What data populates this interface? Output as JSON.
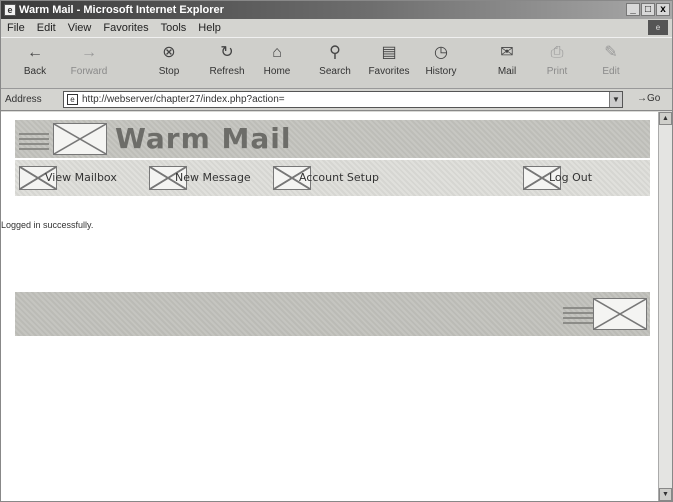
{
  "window": {
    "title": "Warm Mail - Microsoft Internet Explorer",
    "controls": [
      "_",
      "□",
      "x"
    ]
  },
  "menu": {
    "items": [
      "File",
      "Edit",
      "View",
      "Favorites",
      "Tools",
      "Help"
    ]
  },
  "toolbar": {
    "back": "Back",
    "forward": "Forward",
    "stop": "Stop",
    "refresh": "Refresh",
    "home": "Home",
    "search": "Search",
    "favorites": "Favorites",
    "history": "History",
    "mail": "Mail",
    "print": "Print",
    "edit": "Edit"
  },
  "address": {
    "label": "Address",
    "url": "http://webserver/chapter27/index.php?action=",
    "go_label": "Go"
  },
  "page": {
    "brand_title": "Warm Mail",
    "nav": {
      "view_mailbox": "View Mailbox",
      "new_message": "New Message",
      "account_setup": "Account Setup",
      "log_out": "Log Out"
    },
    "status_message": "Logged in successfully."
  }
}
